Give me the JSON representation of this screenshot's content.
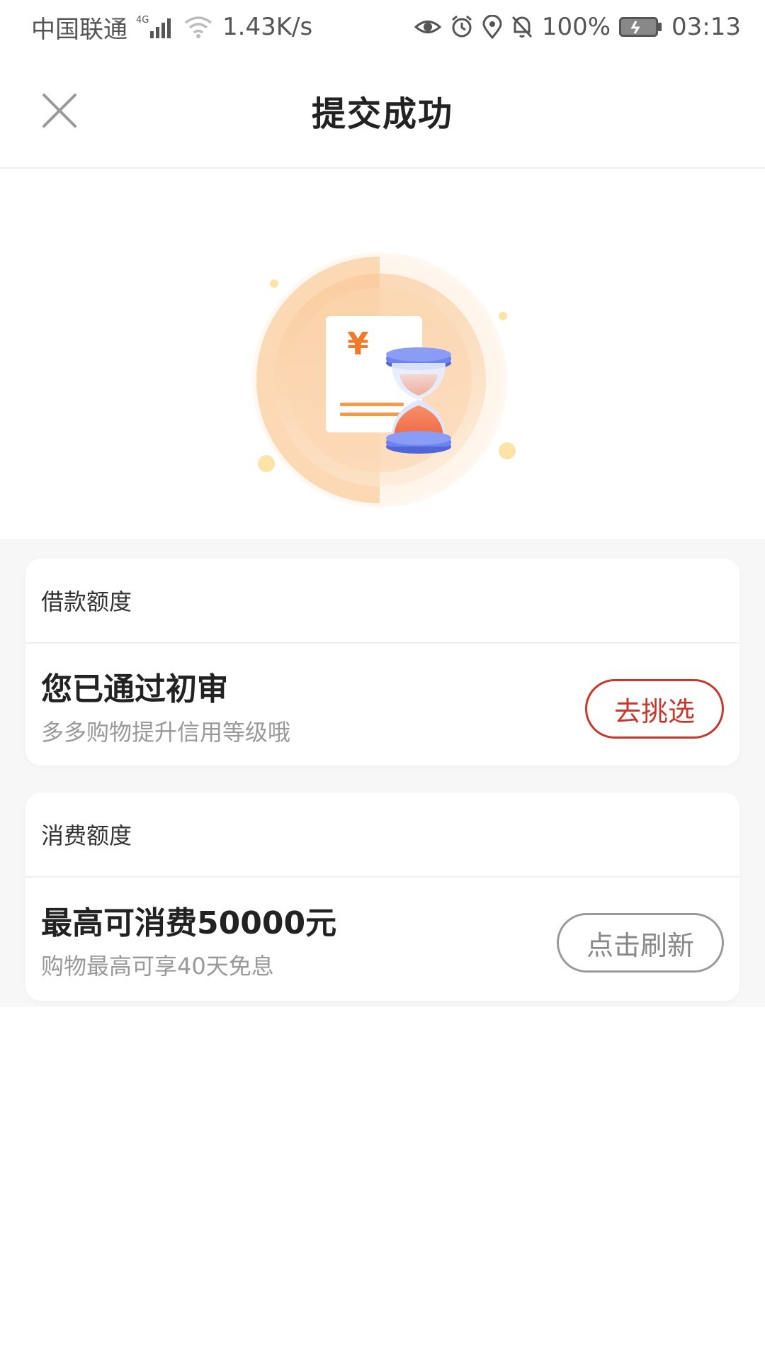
{
  "status_bar": {
    "carrier": "中国联通",
    "network_type": "4G",
    "speed": "1.43K/s",
    "battery": "100%",
    "time": "03:13",
    "icons": [
      "signal-icon",
      "wifi-icon",
      "eye-icon",
      "alarm-icon",
      "location-icon",
      "mute-bell-icon",
      "battery-icon"
    ]
  },
  "header": {
    "title": "提交成功",
    "close_icon": "close-icon"
  },
  "illustration": {
    "currency_symbol": "¥",
    "icon": "hourglass-document-illustration"
  },
  "cards": {
    "loan": {
      "header": "借款额度",
      "title": "您已通过初审",
      "subtitle": "多多购物提升信用等级哦",
      "button": "去挑选",
      "button_color": "#c7372c"
    },
    "consumption": {
      "header": "消费额度",
      "title": "最高可消费50000元",
      "subtitle": "购物最高可享40天免息",
      "button": "点击刷新",
      "button_color": "#9a9a9a"
    }
  },
  "colors": {
    "accent_orange": "#f7b26a",
    "hourglass_blue": "#5b74e8",
    "background": "#f7f7f7"
  }
}
